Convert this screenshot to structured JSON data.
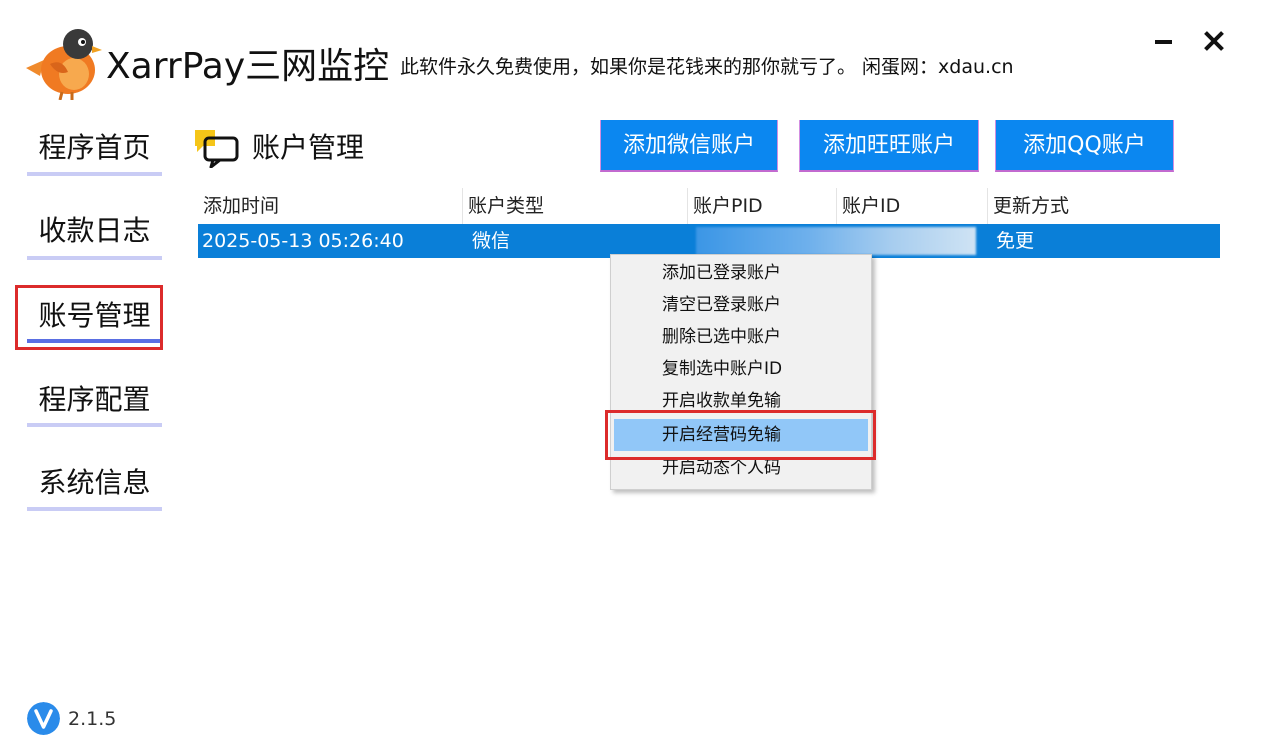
{
  "app": {
    "title": "XarrPay三网监控",
    "subtitle": "此软件永久免费使用，如果你是花钱来的那你就亏了。 闲蛋网：xdau.cn",
    "version": "2.1.5"
  },
  "window_controls": {
    "minimize_icon": "minimize-icon",
    "close_icon": "close-icon"
  },
  "sidebar": {
    "items": [
      {
        "label": "程序首页",
        "active": false
      },
      {
        "label": "收款日志",
        "active": false
      },
      {
        "label": "账号管理",
        "active": true
      },
      {
        "label": "程序配置",
        "active": false
      },
      {
        "label": "系统信息",
        "active": false
      }
    ]
  },
  "section": {
    "title": "账户管理",
    "icon": "chat-bubble-icon"
  },
  "actions": {
    "add_wechat": "添加微信账户",
    "add_wangwang": "添加旺旺账户",
    "add_qq": "添加QQ账户"
  },
  "table": {
    "columns": [
      "添加时间",
      "账户类型",
      "账户PID",
      "账户ID",
      "更新方式"
    ],
    "rows": [
      {
        "time": "2025-05-13 05:26:40",
        "type": "微信",
        "pid": "",
        "id": "",
        "update": "免更"
      }
    ]
  },
  "context_menu": {
    "items": [
      "添加已登录账户",
      "清空已登录账户",
      "删除已选中账户",
      "复制选中账户ID",
      "开启收款单免输",
      "开启经营码免输",
      "开启动态个人码"
    ],
    "hover_index": 5
  },
  "colors": {
    "accent": "#0b87f0",
    "selected_row": "#0a7fd8",
    "menu_hover": "#91c7f8",
    "nav_bar": "#c9ccf5",
    "nav_bar_active": "#5a6fe3",
    "annotation_red": "#dc2b2b"
  }
}
